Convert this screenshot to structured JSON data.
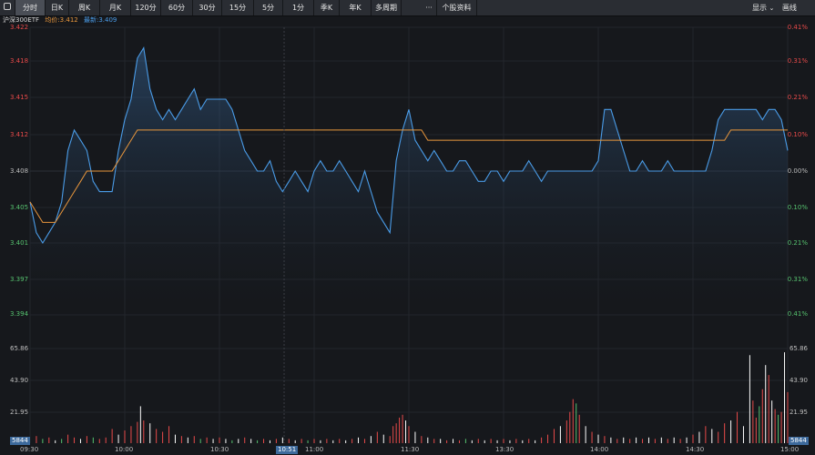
{
  "toolbar": {
    "tabs": [
      "分时",
      "日K",
      "周K",
      "月K",
      "120分",
      "60分",
      "30分",
      "15分",
      "5分",
      "1分",
      "季K",
      "年K",
      "多周期"
    ],
    "more": "···",
    "stock_info": "个股资料",
    "display": "显示",
    "draw": "画线",
    "colors": {
      "active_tab": "#4a4e56",
      "bar": "#2a2d33"
    }
  },
  "info": {
    "name": "沪深300ETF",
    "avg_label": "均价:3.412",
    "last_label": "最新:3.409",
    "avg_color": "#e8963c",
    "last_color": "#4a9ce8"
  },
  "price_axis": {
    "left": [
      "3.422",
      "3.418",
      "3.415",
      "3.412",
      "3.408",
      "3.405",
      "3.401",
      "3.397",
      "3.394"
    ],
    "right": [
      "0.41%",
      "0.31%",
      "0.21%",
      "0.10%",
      "0.00%",
      "0.10%",
      "0.21%",
      "0.31%",
      "0.41%"
    ]
  },
  "volume_axis": {
    "left": [
      "65.86",
      "43.90",
      "21.95"
    ],
    "right": [
      "65.86",
      "43.90",
      "21.95"
    ]
  },
  "vol_box": {
    "left": "5844",
    "right": "5844"
  },
  "time_labels": [
    "09:30",
    "10:00",
    "10:30",
    "11:00",
    "11:30",
    "13:30",
    "14:00",
    "14:30",
    "15:00"
  ],
  "cursor_time": "10:51",
  "chart_data": {
    "type": "line",
    "ylim": [
      3.394,
      3.422
    ],
    "vol_ylim": [
      0,
      87.8
    ],
    "colors": {
      "price": "#4a9ce8",
      "avg": "#e8963c",
      "up": "#e84a4a",
      "down": "#ffffff",
      "flat": "#56c26f"
    },
    "x": [
      0,
      2,
      4,
      6,
      8,
      10,
      12,
      14,
      16,
      18,
      20,
      22,
      24,
      26,
      28,
      30,
      32,
      34,
      36,
      38,
      40,
      42,
      44,
      46,
      48,
      50,
      52,
      54,
      56,
      58,
      60,
      62,
      64,
      66,
      68,
      70,
      72,
      74,
      76,
      78,
      80,
      82,
      84,
      86,
      88,
      90,
      92,
      94,
      96,
      98,
      100,
      102,
      104,
      106,
      108,
      110,
      112,
      114,
      116,
      118,
      120,
      122,
      124,
      126,
      128,
      130,
      132,
      134,
      136,
      138,
      140,
      142,
      144,
      146,
      148,
      150,
      152,
      154,
      156,
      158,
      160,
      162,
      164,
      166,
      168,
      170,
      172,
      174,
      176,
      178,
      180,
      182,
      184,
      186,
      188,
      190,
      192,
      194,
      196,
      198,
      200,
      202,
      204,
      206,
      208,
      210,
      212,
      214,
      216,
      218,
      220,
      222,
      224,
      226,
      228,
      230,
      232,
      234,
      236,
      238,
      240
    ],
    "price": [
      3.405,
      3.402,
      3.401,
      3.402,
      3.403,
      3.405,
      3.41,
      3.412,
      3.411,
      3.41,
      3.407,
      3.406,
      3.406,
      3.406,
      3.41,
      3.413,
      3.415,
      3.419,
      3.42,
      3.416,
      3.414,
      3.413,
      3.414,
      3.413,
      3.414,
      3.415,
      3.416,
      3.414,
      3.415,
      3.415,
      3.415,
      3.415,
      3.414,
      3.412,
      3.41,
      3.409,
      3.408,
      3.408,
      3.409,
      3.407,
      3.406,
      3.407,
      3.408,
      3.407,
      3.406,
      3.408,
      3.409,
      3.408,
      3.408,
      3.409,
      3.408,
      3.407,
      3.406,
      3.408,
      3.406,
      3.404,
      3.403,
      3.402,
      3.409,
      3.412,
      3.414,
      3.411,
      3.41,
      3.409,
      3.41,
      3.409,
      3.408,
      3.408,
      3.409,
      3.409,
      3.408,
      3.407,
      3.407,
      3.408,
      3.408,
      3.407,
      3.408,
      3.408,
      3.408,
      3.409,
      3.408,
      3.407,
      3.408,
      3.408,
      3.408,
      3.408,
      3.408,
      3.408,
      3.408,
      3.408,
      3.409,
      3.414,
      3.414,
      3.412,
      3.41,
      3.408,
      3.408,
      3.409,
      3.408,
      3.408,
      3.408,
      3.409,
      3.408,
      3.408,
      3.408,
      3.408,
      3.408,
      3.408,
      3.41,
      3.413,
      3.414,
      3.414,
      3.414,
      3.414,
      3.414,
      3.414,
      3.413,
      3.414,
      3.414,
      3.413,
      3.41
    ],
    "avg": [
      3.405,
      3.404,
      3.403,
      3.403,
      3.403,
      3.404,
      3.405,
      3.406,
      3.407,
      3.408,
      3.408,
      3.408,
      3.408,
      3.408,
      3.409,
      3.41,
      3.411,
      3.412,
      3.412,
      3.412,
      3.412,
      3.412,
      3.412,
      3.412,
      3.412,
      3.412,
      3.412,
      3.412,
      3.412,
      3.412,
      3.412,
      3.412,
      3.412,
      3.412,
      3.412,
      3.412,
      3.412,
      3.412,
      3.412,
      3.412,
      3.412,
      3.412,
      3.412,
      3.412,
      3.412,
      3.412,
      3.412,
      3.412,
      3.412,
      3.412,
      3.412,
      3.412,
      3.412,
      3.412,
      3.412,
      3.412,
      3.412,
      3.412,
      3.412,
      3.412,
      3.412,
      3.412,
      3.412,
      3.411,
      3.411,
      3.411,
      3.411,
      3.411,
      3.411,
      3.411,
      3.411,
      3.411,
      3.411,
      3.411,
      3.411,
      3.411,
      3.411,
      3.411,
      3.411,
      3.411,
      3.411,
      3.411,
      3.411,
      3.411,
      3.411,
      3.411,
      3.411,
      3.411,
      3.411,
      3.411,
      3.411,
      3.411,
      3.411,
      3.411,
      3.411,
      3.411,
      3.411,
      3.411,
      3.411,
      3.411,
      3.411,
      3.411,
      3.411,
      3.411,
      3.411,
      3.411,
      3.411,
      3.411,
      3.411,
      3.411,
      3.411,
      3.412,
      3.412,
      3.412,
      3.412,
      3.412,
      3.412,
      3.412,
      3.412,
      3.412,
      3.412,
      3.412,
      3.412
    ],
    "volume": [
      {
        "x": 2,
        "v": 5,
        "d": "up"
      },
      {
        "x": 4,
        "v": 3,
        "d": "flat"
      },
      {
        "x": 6,
        "v": 4,
        "d": "up"
      },
      {
        "x": 8,
        "v": 2,
        "d": "down"
      },
      {
        "x": 10,
        "v": 3,
        "d": "flat"
      },
      {
        "x": 12,
        "v": 6,
        "d": "up"
      },
      {
        "x": 14,
        "v": 4,
        "d": "up"
      },
      {
        "x": 16,
        "v": 3,
        "d": "down"
      },
      {
        "x": 18,
        "v": 5,
        "d": "up"
      },
      {
        "x": 20,
        "v": 4,
        "d": "flat"
      },
      {
        "x": 22,
        "v": 3,
        "d": "up"
      },
      {
        "x": 24,
        "v": 4,
        "d": "up"
      },
      {
        "x": 26,
        "v": 10,
        "d": "up"
      },
      {
        "x": 28,
        "v": 6,
        "d": "down"
      },
      {
        "x": 30,
        "v": 9,
        "d": "up"
      },
      {
        "x": 32,
        "v": 12,
        "d": "up"
      },
      {
        "x": 34,
        "v": 15,
        "d": "up"
      },
      {
        "x": 35,
        "v": 26,
        "d": "down"
      },
      {
        "x": 36,
        "v": 16,
        "d": "up"
      },
      {
        "x": 38,
        "v": 14,
        "d": "down"
      },
      {
        "x": 40,
        "v": 10,
        "d": "up"
      },
      {
        "x": 42,
        "v": 8,
        "d": "up"
      },
      {
        "x": 44,
        "v": 12,
        "d": "up"
      },
      {
        "x": 46,
        "v": 6,
        "d": "down"
      },
      {
        "x": 48,
        "v": 5,
        "d": "up"
      },
      {
        "x": 50,
        "v": 4,
        "d": "down"
      },
      {
        "x": 52,
        "v": 5,
        "d": "up"
      },
      {
        "x": 54,
        "v": 3,
        "d": "flat"
      },
      {
        "x": 56,
        "v": 4,
        "d": "up"
      },
      {
        "x": 58,
        "v": 3,
        "d": "down"
      },
      {
        "x": 60,
        "v": 4,
        "d": "up"
      },
      {
        "x": 62,
        "v": 3,
        "d": "down"
      },
      {
        "x": 64,
        "v": 2,
        "d": "flat"
      },
      {
        "x": 66,
        "v": 3,
        "d": "down"
      },
      {
        "x": 68,
        "v": 4,
        "d": "up"
      },
      {
        "x": 70,
        "v": 3,
        "d": "down"
      },
      {
        "x": 72,
        "v": 2,
        "d": "flat"
      },
      {
        "x": 74,
        "v": 3,
        "d": "up"
      },
      {
        "x": 76,
        "v": 2,
        "d": "down"
      },
      {
        "x": 78,
        "v": 3,
        "d": "up"
      },
      {
        "x": 80,
        "v": 4,
        "d": "down"
      },
      {
        "x": 82,
        "v": 3,
        "d": "up"
      },
      {
        "x": 84,
        "v": 2,
        "d": "down"
      },
      {
        "x": 86,
        "v": 3,
        "d": "up"
      },
      {
        "x": 88,
        "v": 2,
        "d": "flat"
      },
      {
        "x": 90,
        "v": 3,
        "d": "up"
      },
      {
        "x": 92,
        "v": 2,
        "d": "down"
      },
      {
        "x": 94,
        "v": 3,
        "d": "up"
      },
      {
        "x": 96,
        "v": 2,
        "d": "down"
      },
      {
        "x": 98,
        "v": 3,
        "d": "up"
      },
      {
        "x": 100,
        "v": 2,
        "d": "down"
      },
      {
        "x": 102,
        "v": 3,
        "d": "up"
      },
      {
        "x": 104,
        "v": 4,
        "d": "down"
      },
      {
        "x": 106,
        "v": 3,
        "d": "up"
      },
      {
        "x": 108,
        "v": 5,
        "d": "down"
      },
      {
        "x": 110,
        "v": 8,
        "d": "up"
      },
      {
        "x": 112,
        "v": 6,
        "d": "down"
      },
      {
        "x": 114,
        "v": 5,
        "d": "up"
      },
      {
        "x": 115,
        "v": 12,
        "d": "up"
      },
      {
        "x": 116,
        "v": 14,
        "d": "up"
      },
      {
        "x": 117,
        "v": 18,
        "d": "up"
      },
      {
        "x": 118,
        "v": 20,
        "d": "up"
      },
      {
        "x": 119,
        "v": 16,
        "d": "down"
      },
      {
        "x": 120,
        "v": 12,
        "d": "up"
      },
      {
        "x": 122,
        "v": 8,
        "d": "down"
      },
      {
        "x": 124,
        "v": 5,
        "d": "up"
      },
      {
        "x": 126,
        "v": 4,
        "d": "down"
      },
      {
        "x": 128,
        "v": 3,
        "d": "up"
      },
      {
        "x": 130,
        "v": 3,
        "d": "down"
      },
      {
        "x": 132,
        "v": 2,
        "d": "up"
      },
      {
        "x": 134,
        "v": 3,
        "d": "down"
      },
      {
        "x": 136,
        "v": 2,
        "d": "up"
      },
      {
        "x": 138,
        "v": 3,
        "d": "flat"
      },
      {
        "x": 140,
        "v": 2,
        "d": "down"
      },
      {
        "x": 142,
        "v": 3,
        "d": "up"
      },
      {
        "x": 144,
        "v": 2,
        "d": "down"
      },
      {
        "x": 146,
        "v": 3,
        "d": "up"
      },
      {
        "x": 148,
        "v": 2,
        "d": "down"
      },
      {
        "x": 150,
        "v": 3,
        "d": "up"
      },
      {
        "x": 152,
        "v": 2,
        "d": "down"
      },
      {
        "x": 154,
        "v": 3,
        "d": "up"
      },
      {
        "x": 156,
        "v": 2,
        "d": "down"
      },
      {
        "x": 158,
        "v": 3,
        "d": "up"
      },
      {
        "x": 160,
        "v": 2,
        "d": "down"
      },
      {
        "x": 162,
        "v": 4,
        "d": "up"
      },
      {
        "x": 164,
        "v": 6,
        "d": "up"
      },
      {
        "x": 166,
        "v": 10,
        "d": "up"
      },
      {
        "x": 168,
        "v": 12,
        "d": "down"
      },
      {
        "x": 170,
        "v": 16,
        "d": "up"
      },
      {
        "x": 171,
        "v": 22,
        "d": "up"
      },
      {
        "x": 172,
        "v": 31,
        "d": "up"
      },
      {
        "x": 173,
        "v": 28,
        "d": "flat"
      },
      {
        "x": 174,
        "v": 20,
        "d": "up"
      },
      {
        "x": 176,
        "v": 12,
        "d": "down"
      },
      {
        "x": 178,
        "v": 8,
        "d": "up"
      },
      {
        "x": 180,
        "v": 6,
        "d": "down"
      },
      {
        "x": 182,
        "v": 5,
        "d": "up"
      },
      {
        "x": 184,
        "v": 4,
        "d": "down"
      },
      {
        "x": 186,
        "v": 3,
        "d": "up"
      },
      {
        "x": 188,
        "v": 4,
        "d": "down"
      },
      {
        "x": 190,
        "v": 3,
        "d": "up"
      },
      {
        "x": 192,
        "v": 4,
        "d": "down"
      },
      {
        "x": 194,
        "v": 3,
        "d": "up"
      },
      {
        "x": 196,
        "v": 4,
        "d": "down"
      },
      {
        "x": 198,
        "v": 3,
        "d": "up"
      },
      {
        "x": 200,
        "v": 4,
        "d": "down"
      },
      {
        "x": 202,
        "v": 3,
        "d": "up"
      },
      {
        "x": 204,
        "v": 4,
        "d": "down"
      },
      {
        "x": 206,
        "v": 3,
        "d": "up"
      },
      {
        "x": 208,
        "v": 4,
        "d": "down"
      },
      {
        "x": 210,
        "v": 6,
        "d": "up"
      },
      {
        "x": 212,
        "v": 8,
        "d": "down"
      },
      {
        "x": 214,
        "v": 12,
        "d": "up"
      },
      {
        "x": 216,
        "v": 10,
        "d": "down"
      },
      {
        "x": 218,
        "v": 8,
        "d": "up"
      },
      {
        "x": 220,
        "v": 14,
        "d": "up"
      },
      {
        "x": 222,
        "v": 16,
        "d": "down"
      },
      {
        "x": 224,
        "v": 22,
        "d": "up"
      },
      {
        "x": 226,
        "v": 12,
        "d": "down"
      },
      {
        "x": 228,
        "v": 62,
        "d": "down"
      },
      {
        "x": 229,
        "v": 30,
        "d": "up"
      },
      {
        "x": 230,
        "v": 18,
        "d": "up"
      },
      {
        "x": 231,
        "v": 26,
        "d": "flat"
      },
      {
        "x": 232,
        "v": 38,
        "d": "up"
      },
      {
        "x": 233,
        "v": 55,
        "d": "down"
      },
      {
        "x": 234,
        "v": 48,
        "d": "up"
      },
      {
        "x": 235,
        "v": 30,
        "d": "down"
      },
      {
        "x": 236,
        "v": 24,
        "d": "up"
      },
      {
        "x": 237,
        "v": 20,
        "d": "flat"
      },
      {
        "x": 238,
        "v": 22,
        "d": "up"
      },
      {
        "x": 239,
        "v": 64,
        "d": "down"
      },
      {
        "x": 240,
        "v": 36,
        "d": "up"
      }
    ]
  }
}
